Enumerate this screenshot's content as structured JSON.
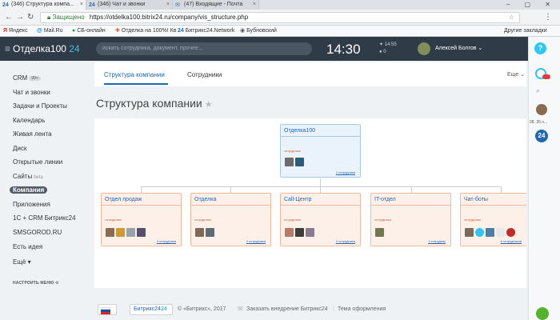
{
  "browser": {
    "tabs": [
      {
        "favicon": "24",
        "title": "(346) Структура компа..."
      },
      {
        "favicon": "24",
        "title": "(346) Чат и звонки"
      },
      {
        "favicon": "✉",
        "title": "(47) Входящие - Почта"
      }
    ],
    "security_text": "Защищено",
    "url": "https://otdelka100.bitrix24.ru/company/vis_structure.php",
    "bookmarks": [
      {
        "icon": "Я",
        "label": "Яндекс",
        "color": "#e52620"
      },
      {
        "icon": "@",
        "label": "Mail.Ru",
        "color": "#168de2"
      },
      {
        "icon": "●",
        "label": "СБ-онлайн",
        "color": "#21a038"
      },
      {
        "icon": "✚",
        "label": "Отделка на 100%! Кв",
        "color": "#e25b2a"
      },
      {
        "icon": "24",
        "label": "Битрикс24.Network",
        "color": "#1f6fb2"
      },
      {
        "icon": "◉",
        "label": "Бубновский",
        "color": "#555555"
      }
    ],
    "other_bookmarks": "Другие закладки"
  },
  "header": {
    "logo_name": "Отделка100",
    "logo_num": "24",
    "search_placeholder": "искать сотрудника, документ, прочее...",
    "clock": "14:30",
    "clock_info_1": "✦ 14:55",
    "clock_info_2": "● 0",
    "user_name": "Алексей Болгов ⌄"
  },
  "left_menu": {
    "items": [
      {
        "label": "CRM",
        "badge": "99+"
      },
      {
        "label": "Чат и звонки"
      },
      {
        "label": "Задачи и Проекты"
      },
      {
        "label": "Календарь"
      },
      {
        "label": "Живая лента"
      },
      {
        "label": "Диск"
      },
      {
        "label": "Открытые линии"
      },
      {
        "label": "Сайты",
        "beta": "beta"
      },
      {
        "label": "Компания",
        "active": true
      },
      {
        "label": "Приложения"
      },
      {
        "label": "1С + CRM Битрикс24"
      },
      {
        "label": "SMSGOROD.RU"
      },
      {
        "label": "Есть идея"
      },
      {
        "label": "Ещё ▾"
      }
    ],
    "settings": "НАСТРОИТЬ МЕНЮ ⚙"
  },
  "content": {
    "tabs": [
      "Структура компании",
      "Сотрудники"
    ],
    "more": "Еще ⌄",
    "title": "Структура компании",
    "structure": {
      "root": {
        "name": "Отделка100",
        "role": "сотрудники",
        "people": "2 сотрудника"
      },
      "departments": [
        {
          "name": "Отдел продаж",
          "role": "сотрудники",
          "people": "4 сотрудника"
        },
        {
          "name": "Отделка",
          "role": "сотрудники",
          "people": "2 сотрудника"
        },
        {
          "name": "Call-Центр",
          "role": "сотрудники",
          "people": "3 сотрудника"
        },
        {
          "name": "IT-отдел",
          "role": "сотрудники",
          "people": "1 сотрудник"
        },
        {
          "name": "Чат-боты",
          "role": "сотрудники",
          "people": "6 сотрудников"
        }
      ]
    }
  },
  "right_panel": {
    "date_label": "08, 26 н..."
  },
  "footer": {
    "b24_label": "Битрикс24",
    "copyright": "© «Битрикс», 2017",
    "order": "Заказать внедрение Битрикс24",
    "theme": "Тема оформления"
  }
}
